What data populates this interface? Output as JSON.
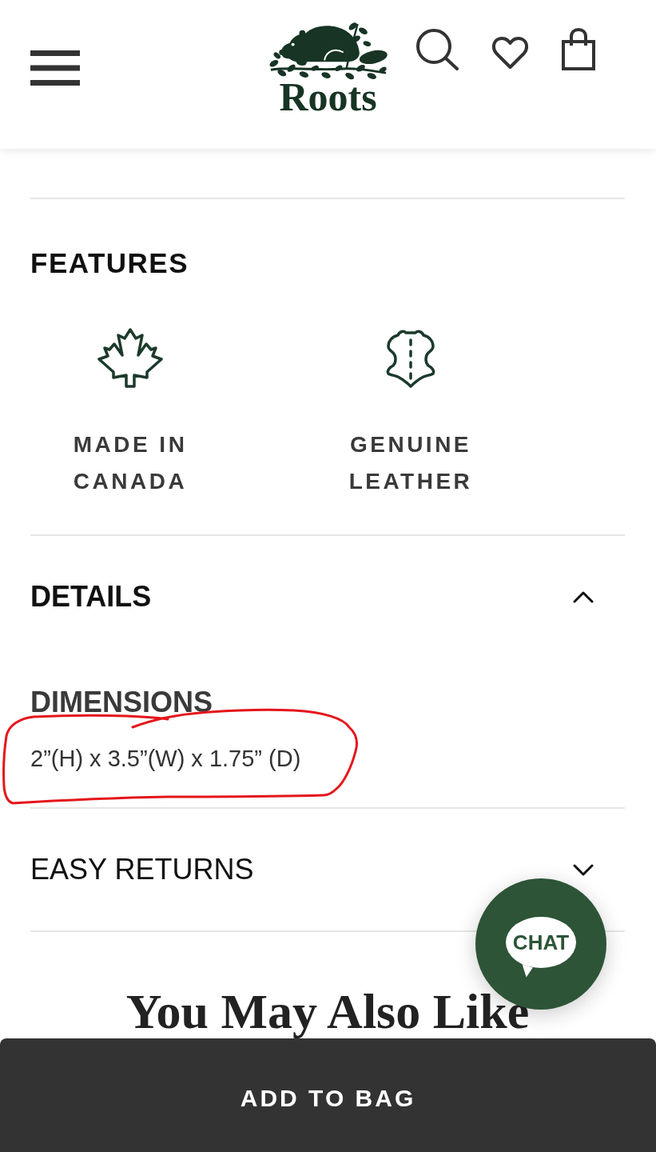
{
  "header": {
    "logo_text": "Roots"
  },
  "features": {
    "title": "FEATURES",
    "items": [
      {
        "kind": "maple-leaf",
        "label": "MADE IN CANADA"
      },
      {
        "kind": "leather-hide",
        "label": "GENUINE LEATHER"
      }
    ]
  },
  "accordion": [
    {
      "title": "DETAILS",
      "expanded": true,
      "content": [
        {
          "heading": "DIMENSIONS",
          "value": "2”(H) x 3.5”(W) x 1.75” (D)",
          "circled": true
        }
      ]
    },
    {
      "title": "EASY RETURNS",
      "expanded": false
    }
  ],
  "recommendations": {
    "title": "You May Also Like"
  },
  "chat_button": {
    "label": "CHAT"
  },
  "add_to_bag": {
    "label": "ADD TO BAG"
  }
}
